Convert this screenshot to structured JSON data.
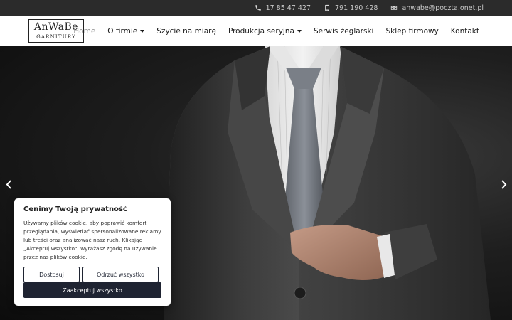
{
  "contact": {
    "phone": "17 85 47 427",
    "mobile": "791 190 428",
    "email": "anwabe@poczta.onet.pl"
  },
  "logo": {
    "main": "AnWaBe",
    "sub": "GARNITURY"
  },
  "nav": {
    "items": [
      {
        "label": "Home",
        "dropdown": false
      },
      {
        "label": "O firmie",
        "dropdown": true
      },
      {
        "label": "Szycie na miarę",
        "dropdown": false
      },
      {
        "label": "Produkcja seryjna",
        "dropdown": true
      },
      {
        "label": "Serwis żeglarski",
        "dropdown": false
      },
      {
        "label": "Sklep firmowy",
        "dropdown": false
      },
      {
        "label": "Kontakt",
        "dropdown": false
      }
    ],
    "active": "Home"
  },
  "hero": {
    "icons": {
      "previous": "chevron-left-icon",
      "next": "chevron-right-icon"
    }
  },
  "cookie": {
    "title": "Cenimy Twoją prywatność",
    "text_lines": [
      "Używamy plików cookie, aby poprawić komfort",
      "przeglądania, wyświetlać spersonalizowane reklamy",
      "lub treści oraz analizować nasz ruch. Klikając",
      "„Akceptuj wszystko\", wyrażasz zgodę na używanie",
      "przez nas plików cookie."
    ],
    "customize_label": "Dostosuj",
    "reject_label": "Odrzuć wszystko",
    "accept_label": "Zaakceptuj wszystko"
  },
  "colors": {
    "topbar": "#2b2b2b",
    "primary_button": "#1f2432",
    "nav_active": "#9a9a9a"
  }
}
